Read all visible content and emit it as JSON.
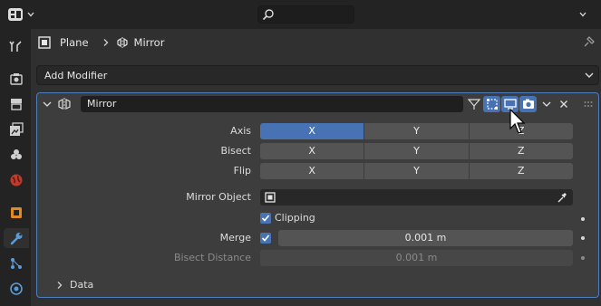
{
  "breadcrumb": {
    "object": "Plane",
    "modifier": "Mirror"
  },
  "add_modifier": {
    "label": "Add Modifier"
  },
  "modifier": {
    "name": "Mirror",
    "axis": {
      "label": "Axis",
      "options": [
        "X",
        "Y",
        "Z"
      ],
      "active": "X"
    },
    "bisect": {
      "label": "Bisect",
      "options": [
        "X",
        "Y",
        "Z"
      ]
    },
    "flip": {
      "label": "Flip",
      "options": [
        "X",
        "Y",
        "Z"
      ]
    },
    "mirror_object": {
      "label": "Mirror Object",
      "value": ""
    },
    "clipping": {
      "label": "Clipping",
      "checked": true
    },
    "merge": {
      "label": "Merge",
      "checked": true,
      "value": "0.001 m"
    },
    "bisect_distance": {
      "label": "Bisect Distance",
      "value": "0.001 m"
    },
    "data": {
      "label": "Data"
    }
  },
  "colors": {
    "accent": "#4772b3",
    "panel_border": "#4c7ec0",
    "background": "#303030"
  }
}
